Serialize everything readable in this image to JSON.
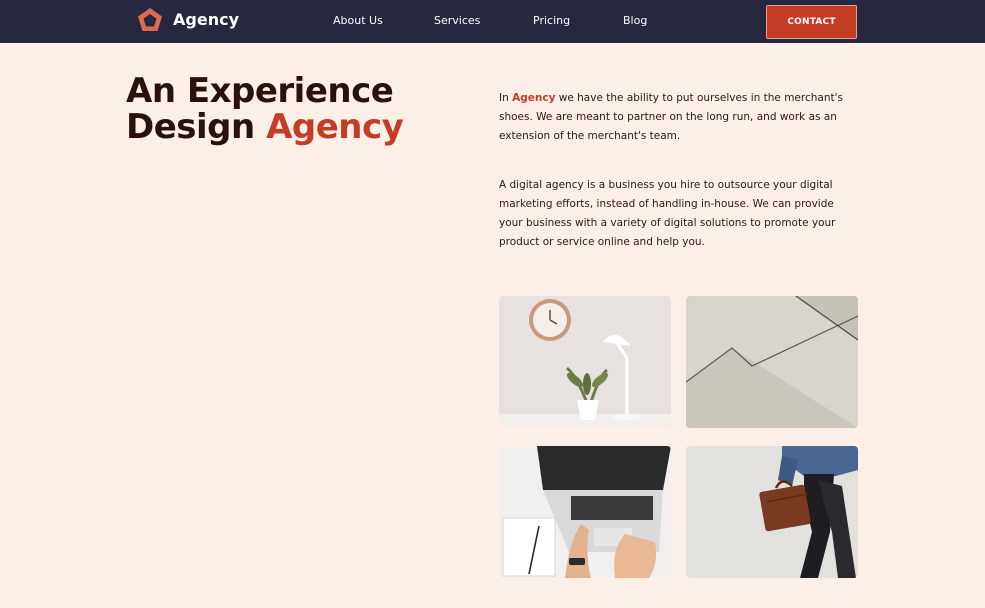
{
  "nav": {
    "logo_text": "Agency",
    "links": [
      "About Us",
      "Services",
      "Pricing",
      "Blog"
    ],
    "contact_label": "CONTACT"
  },
  "hero": {
    "line1": "An Experience",
    "line2": "Design",
    "accent": "Agency"
  },
  "intro": {
    "p1_prefix": "In",
    "brand": "Agency",
    "p1_rest": "we have the ability to put ourselves in the merchant's shoes. We are meant to partner on the long run, and work as an extension of the merchant's team.",
    "p2": "A digital agency is a business you hire to outsource your digital marketing efforts, instead of handling in-house. We can provide your business with a variety of digital solutions to promote your product or service online and help you."
  },
  "colors": {
    "nav_bg": "#262840",
    "accent": "#c43c23",
    "page_bg": "#fcefe8",
    "heading": "#2a1208"
  }
}
